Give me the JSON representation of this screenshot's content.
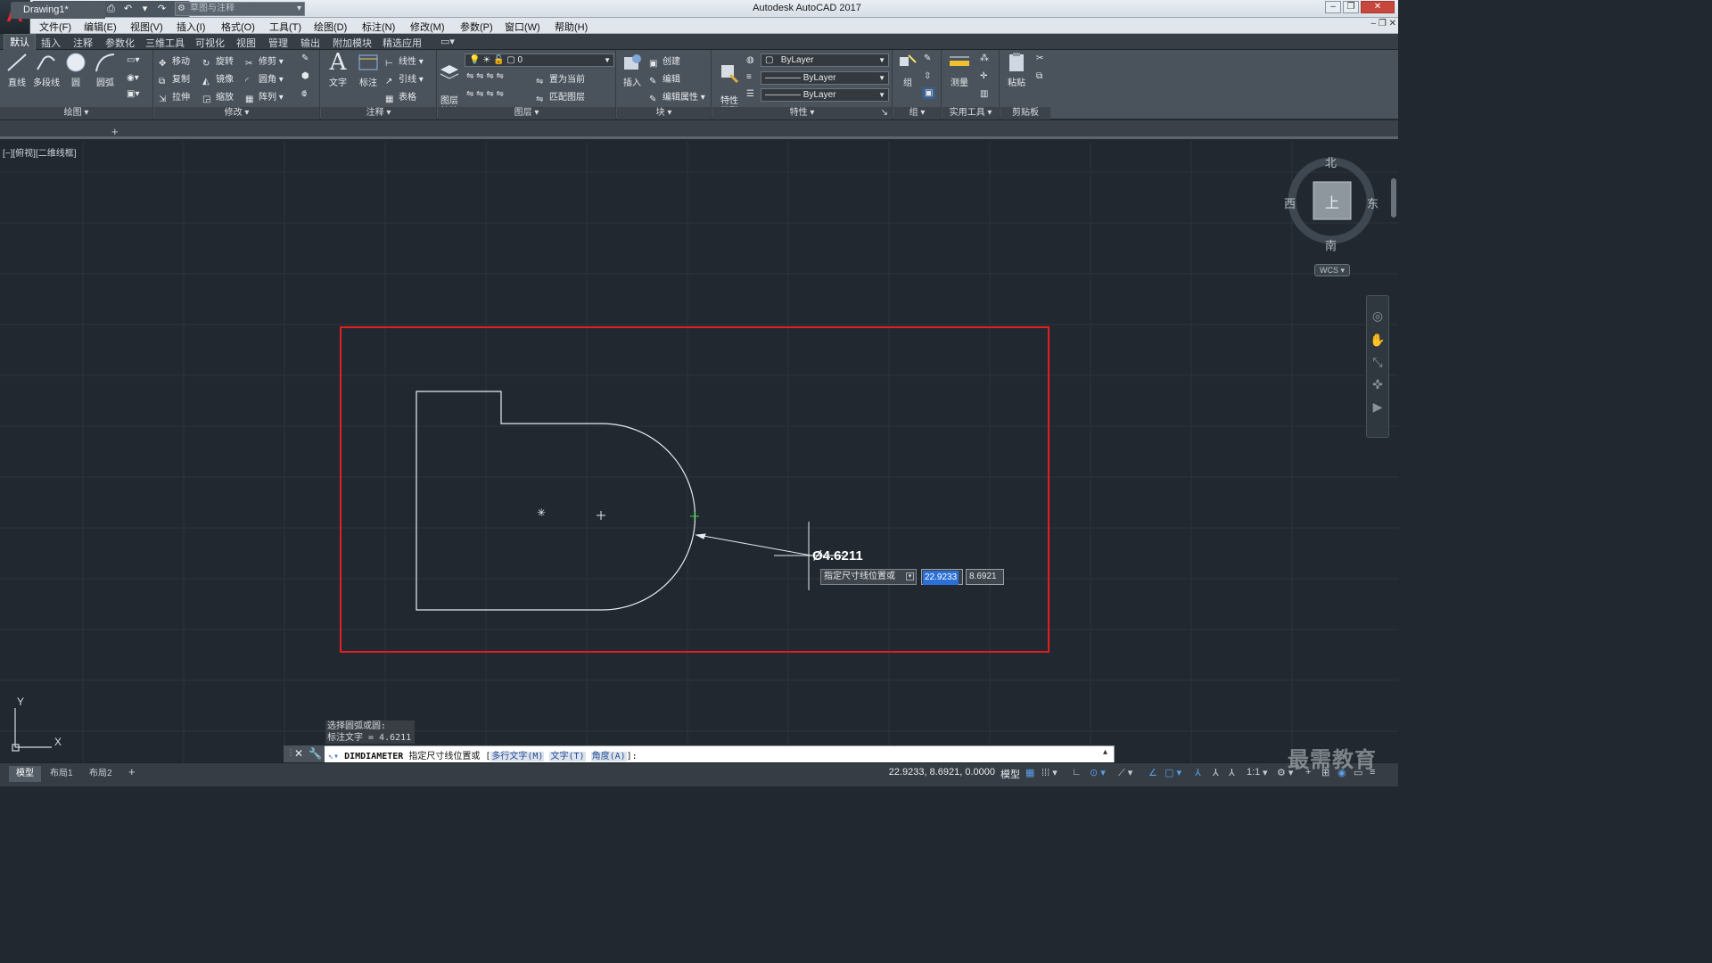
{
  "app": {
    "title": "Autodesk AutoCAD 2017",
    "logo": "A",
    "workspace": "草图与注释"
  },
  "menu": [
    "文件(F)",
    "编辑(E)",
    "视图(V)",
    "插入(I)",
    "格式(O)",
    "工具(T)",
    "绘图(D)",
    "标注(N)",
    "修改(M)",
    "参数(P)",
    "窗口(W)",
    "帮助(H)"
  ],
  "ribbon_tabs": [
    "默认",
    "插入",
    "注释",
    "参数化",
    "三维工具",
    "可视化",
    "视图",
    "管理",
    "输出",
    "附加模块",
    "精选应用"
  ],
  "panels": {
    "draw": {
      "title": "绘图",
      "line": "直线",
      "polyline": "多段线",
      "circle": "圆",
      "arc": "圆弧"
    },
    "modify": {
      "title": "修改",
      "move": "移动",
      "rotate": "旋转",
      "trim": "修剪",
      "copy": "复制",
      "mirror": "镜像",
      "fillet": "圆角",
      "stretch": "拉伸",
      "scale": "缩放",
      "array": "阵列"
    },
    "annotation": {
      "title": "注释",
      "text": "文字",
      "dimension": "标注",
      "linear": "线性",
      "leader": "引线",
      "table": "表格"
    },
    "layers": {
      "title": "图层",
      "layer_props": "图层\n特性",
      "layer_value": "0",
      "set_current": "置为当前",
      "match_layer": "匹配图层"
    },
    "block": {
      "title": "块",
      "insert": "插入",
      "create": "创建",
      "edit": "编辑",
      "edit_attr": "编辑属性"
    },
    "properties": {
      "title": "特性",
      "match": "特性\n匹配",
      "color": "ByLayer",
      "linetype": "ByLayer",
      "lineweight": "ByLayer"
    },
    "groups": {
      "title": "组",
      "group": "组"
    },
    "utilities": {
      "title": "实用工具",
      "measure": "测量"
    },
    "clipboard": {
      "title": "剪贴板",
      "paste": "粘贴"
    }
  },
  "file_tab": {
    "name": "Drawing1*"
  },
  "viewport_label": "[−][俯视][二维线框]",
  "viewcube": {
    "north": "北",
    "south": "南",
    "east": "东",
    "west": "西",
    "face": "上",
    "wcs": "WCS"
  },
  "dimension": {
    "text": "Ø4.6211"
  },
  "dynamic_input": {
    "prompt": "指定尺寸线位置或",
    "x": "22.9233",
    "y": "8.6921"
  },
  "command_history": [
    "选择圆弧或圆:",
    "标注文字 = 4.6211"
  ],
  "command_line": {
    "command": "DIMDIAMETER",
    "prompt": "指定尺寸线位置或",
    "options": [
      "多行文字(M)",
      "文字(T)",
      "角度(A)"
    ],
    "suffix": "]:"
  },
  "layout_tabs": [
    "模型",
    "布局1",
    "布局2"
  ],
  "status": {
    "coords": "22.9233, 8.6921, 0.0000",
    "model": "模型",
    "scale": "1:1"
  },
  "ucs": {
    "x": "X",
    "y": "Y"
  },
  "watermark": "最需教育",
  "colors": {
    "background": "#212830",
    "highlight_rect": "#e02020",
    "geometry": "#ffffff",
    "accent_blue": "#2c6fd6"
  }
}
